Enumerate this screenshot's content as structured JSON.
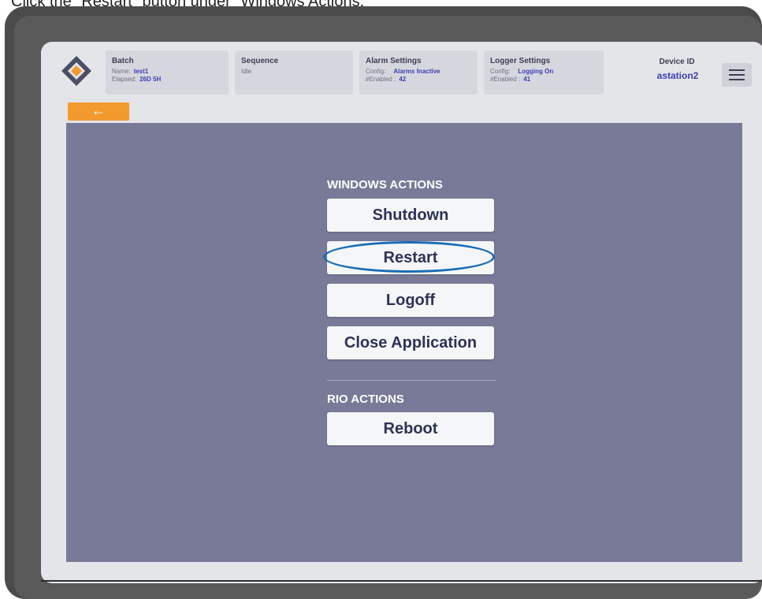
{
  "instruction": "Click the \"Restart\" button under \"Windows Actions.\"",
  "header": {
    "batch": {
      "title": "Batch",
      "name_label": "Name:",
      "name_value": "test1",
      "elapsed_label": "Elapsed:",
      "elapsed_value": "26D 5H"
    },
    "sequence": {
      "title": "Sequence",
      "status": "Idle"
    },
    "alarm_settings": {
      "title": "Alarm Settings",
      "config_label": "Config:",
      "config_value": "Alarms Inactive",
      "enabled_label": "#Enabled :",
      "enabled_value": "42"
    },
    "logger_settings": {
      "title": "Logger Settings",
      "config_label": "Config:",
      "config_value": "Logging On",
      "enabled_label": "#Enabled :",
      "enabled_value": "41"
    },
    "device": {
      "title": "Device ID",
      "value": "astation2"
    },
    "menu_icon": "hamburger-menu-icon",
    "back_icon": "arrow-left-icon",
    "back_label": "←"
  },
  "windows_actions": {
    "heading": "WINDOWS ACTIONS",
    "buttons": [
      "Shutdown",
      "Restart",
      "Logoff",
      "Close Application"
    ]
  },
  "rio_actions": {
    "heading": "RIO ACTIONS",
    "buttons": [
      "Reboot"
    ]
  },
  "colors": {
    "accent_orange": "#f29a2e",
    "content_bg": "#787a98",
    "value_blue": "#3b3fb3",
    "highlight": "#1a6db3"
  }
}
